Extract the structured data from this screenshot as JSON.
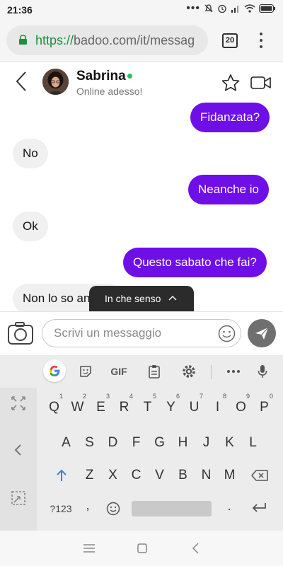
{
  "status_bar": {
    "time": "21:36",
    "icons": [
      "more-dots-icon",
      "silent-bell-icon",
      "alarm-icon",
      "signal-icon",
      "wifi-icon",
      "battery-icon"
    ]
  },
  "browser": {
    "url_scheme": "https://",
    "url_rest": "badoo.com/it/messag",
    "tab_count": "20"
  },
  "chat": {
    "contact_name": "Sabrina",
    "status": "Online adesso!"
  },
  "messages": [
    {
      "text": "Fidanzata?",
      "direction": "out"
    },
    {
      "text": "No",
      "direction": "in"
    },
    {
      "text": "Neanche io",
      "direction": "out"
    },
    {
      "text": "Ok",
      "direction": "in"
    },
    {
      "text": "Questo sabato che fai?",
      "direction": "out"
    },
    {
      "text": "Non lo so ancora",
      "direction": "in"
    }
  ],
  "toast": {
    "label": "In che senso"
  },
  "composer": {
    "placeholder": "Scrivi un messaggio"
  },
  "keyboard": {
    "toolbar": {
      "gif_label": "GIF"
    },
    "row1": [
      "Q",
      "W",
      "E",
      "R",
      "T",
      "Y",
      "U",
      "I",
      "O",
      "P"
    ],
    "row1_hints": [
      "1",
      "2",
      "3",
      "4",
      "5",
      "6",
      "7",
      "8",
      "9",
      "0"
    ],
    "row2": [
      "A",
      "S",
      "D",
      "F",
      "G",
      "H",
      "J",
      "K",
      "L"
    ],
    "row3": [
      "Z",
      "X",
      "C",
      "V",
      "B",
      "N",
      "M"
    ],
    "symbols_label": "?123",
    "comma_label": ",",
    "period_label": "."
  },
  "colors": {
    "accent": "#6e0fe8",
    "online": "#22c55e",
    "url_scheme": "#1e8e3e"
  }
}
